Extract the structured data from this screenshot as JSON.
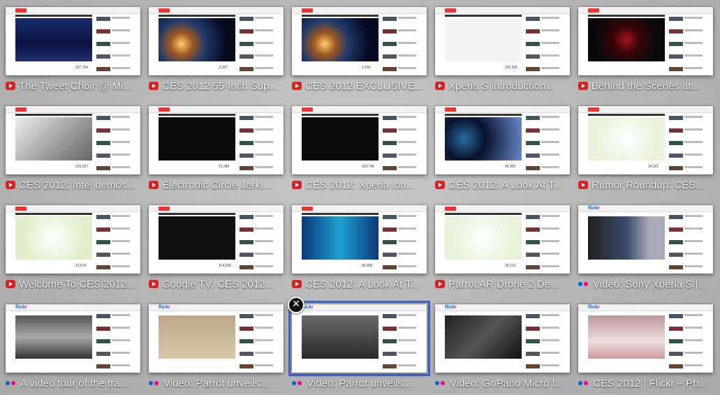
{
  "colors": {
    "youtube": "#d92323",
    "flickr_blue": "#0063dc",
    "flickr_pink": "#ff0084",
    "selection": "#3a5ec9"
  },
  "tiles": [
    {
      "title": "The Tweet Choir @ Mi...",
      "source": "youtube",
      "views": "207,754",
      "scene": "stage"
    },
    {
      "title": "CES 2012 55-Inch Sup...",
      "source": "youtube",
      "views": "3,287",
      "scene": "earth"
    },
    {
      "title": "CES 2012 EXCLUSIVE...",
      "source": "youtube",
      "views": "1,160",
      "scene": "earth"
    },
    {
      "title": "Xperia S introduction...",
      "source": "youtube",
      "views": "220,525",
      "scene": "xperia"
    },
    {
      "title": "Behind the Scenes at...",
      "source": "youtube",
      "views": "",
      "scene": "dark"
    },
    {
      "title": "CES 2012: Intel demos...",
      "source": "youtube",
      "views": "226,027",
      "scene": "intel"
    },
    {
      "title": "Electronic Circle Jerk!...",
      "source": "youtube",
      "views": "21,289",
      "scene": "black"
    },
    {
      "title": "CES 2012: Xperia ion...",
      "source": "youtube",
      "views": "103,746",
      "scene": "black"
    },
    {
      "title": "CES 2012: A Look At T...",
      "source": "youtube",
      "views": "36,905",
      "scene": "sgnl"
    },
    {
      "title": "Rumor Roundup: CES...",
      "source": "youtube",
      "views": "24,321",
      "scene": "greenlogo"
    },
    {
      "title": "Welcome To CES 2012...",
      "source": "youtube",
      "views": "21,674",
      "scene": "greentv"
    },
    {
      "title": "Google TV: CES 2012...",
      "source": "youtube",
      "views": "114,090",
      "scene": "googletv"
    },
    {
      "title": "CES 2012: A Look At T...",
      "source": "youtube",
      "views": "36,905",
      "scene": "sgnlbig"
    },
    {
      "title": "Parrot AR Drone 2 De...",
      "source": "youtube",
      "views": "26,212",
      "scene": "greenlogo"
    },
    {
      "title": "Video: Sony Xperia S |...",
      "source": "flickr",
      "views": "",
      "scene": "flickr1"
    },
    {
      "title": "A video tour of the tra...",
      "source": "flickr",
      "views": "",
      "scene": "flickr2"
    },
    {
      "title": "Video: Parrot unveils...",
      "source": "flickr",
      "views": "",
      "scene": "drone"
    },
    {
      "title": "Video: Parrot unveils...",
      "source": "flickr",
      "views": "",
      "scene": "drone2",
      "selected": true
    },
    {
      "title": "Video: GoPano Micro f...",
      "source": "flickr",
      "views": "",
      "scene": "phone"
    },
    {
      "title": "CES 2012 | Flickr – Ph...",
      "source": "flickr",
      "views": "",
      "scene": "flickr3"
    }
  ],
  "close_glyph": "✕",
  "youtube_logo_text": "YouTube",
  "flickr_logo": {
    "a": "flick",
    "b": "r"
  }
}
